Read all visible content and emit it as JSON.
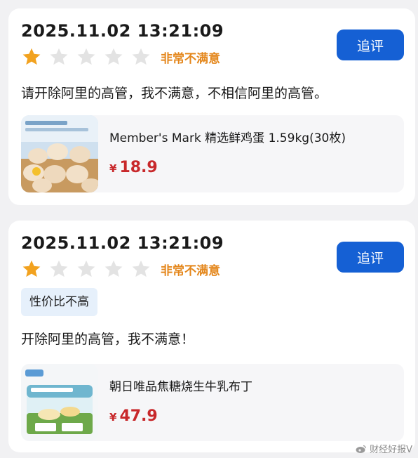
{
  "reviews": [
    {
      "timestamp": "2025.11.02 13:21:09",
      "followup_label": "追评",
      "rating_label": "非常不满意",
      "rating": 1,
      "max_rating": 5,
      "text": "请开除阿里的高管，我不满意，不相信阿里的高管。",
      "product": {
        "name": "Member's Mark 精选鲜鸡蛋 1.59kg(30枚)",
        "currency": "¥",
        "price": "18.9"
      }
    },
    {
      "timestamp": "2025.11.02 13:21:09",
      "followup_label": "追评",
      "rating_label": "非常不满意",
      "rating": 1,
      "max_rating": 5,
      "tag": "性价比不高",
      "text": "开除阿里的高管，我不满意！",
      "product": {
        "name": "朝日唯品焦糖烧生牛乳布丁",
        "currency": "¥",
        "price": "47.9"
      }
    }
  ],
  "watermark": "财经好报V",
  "colors": {
    "accent": "#1560d4",
    "star_filled": "#f2a21f",
    "star_empty": "#e3e3e3",
    "rating_text": "#e4871c",
    "price": "#c8282b",
    "tag_bg": "#e6f0fb"
  }
}
